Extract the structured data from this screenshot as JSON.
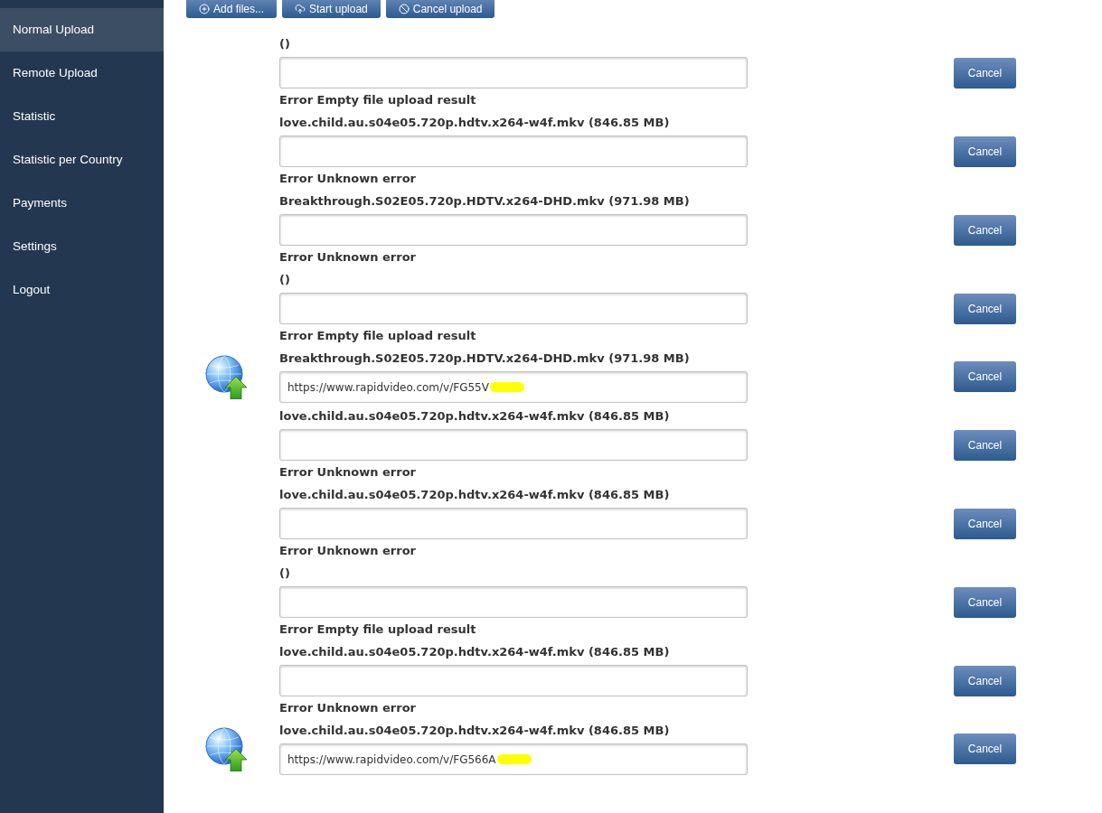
{
  "sidebar": {
    "items": [
      {
        "label": "Normal Upload",
        "selected": true
      },
      {
        "label": "Remote Upload",
        "selected": false
      },
      {
        "label": "Statistic",
        "selected": false
      },
      {
        "label": "Statistic per Country",
        "selected": false
      },
      {
        "label": "Payments",
        "selected": false
      },
      {
        "label": "Settings",
        "selected": false
      },
      {
        "label": "Logout",
        "selected": false
      }
    ]
  },
  "toolbar": [
    {
      "kind": "add",
      "label": "Add files..."
    },
    {
      "kind": "start",
      "label": "Start upload"
    },
    {
      "kind": "cancel",
      "label": "Cancel upload"
    }
  ],
  "uploads": [
    {
      "name": "()",
      "error": "Error Empty file upload result",
      "uploaded": false,
      "redacted": false,
      "button": "Cancel"
    },
    {
      "name": "love.child.au.s04e05.720p.hdtv.x264-w4f.mkv (846.85 MB)",
      "error": "Error Unknown error",
      "uploaded": false,
      "redacted": false,
      "button": "Cancel"
    },
    {
      "name": "Breakthrough.S02E05.720p.HDTV.x264-DHD.mkv (971.98 MB)",
      "error": "Error Unknown error",
      "uploaded": false,
      "redacted": false,
      "button": "Cancel"
    },
    {
      "name": "()",
      "error": "Error Empty file upload result",
      "uploaded": false,
      "redacted": false,
      "button": "Cancel"
    },
    {
      "name": "Breakthrough.S02E05.720p.HDTV.x264-DHD.mkv (971.98 MB)",
      "value": "https://www.rapidvideo.com/v/FG55V",
      "uploaded": true,
      "redacted": true,
      "button": "Cancel"
    },
    {
      "name": "love.child.au.s04e05.720p.hdtv.x264-w4f.mkv (846.85 MB)",
      "error": "Error Unknown error",
      "uploaded": false,
      "redacted": false,
      "button": "Cancel"
    },
    {
      "name": "love.child.au.s04e05.720p.hdtv.x264-w4f.mkv (846.85 MB)",
      "error": "Error Unknown error",
      "uploaded": false,
      "redacted": false,
      "button": "Cancel"
    },
    {
      "name": "()",
      "error": "Error Empty file upload result",
      "uploaded": false,
      "redacted": false,
      "button": "Cancel"
    },
    {
      "name": "love.child.au.s04e05.720p.hdtv.x264-w4f.mkv (846.85 MB)",
      "error": "Error Unknown error",
      "uploaded": false,
      "redacted": false,
      "button": "Cancel"
    },
    {
      "name": "love.child.au.s04e05.720p.hdtv.x264-w4f.mkv (846.85 MB)",
      "value": "https://www.rapidvideo.com/v/FG566A",
      "uploaded": true,
      "redacted": true,
      "button": "Cancel"
    }
  ]
}
